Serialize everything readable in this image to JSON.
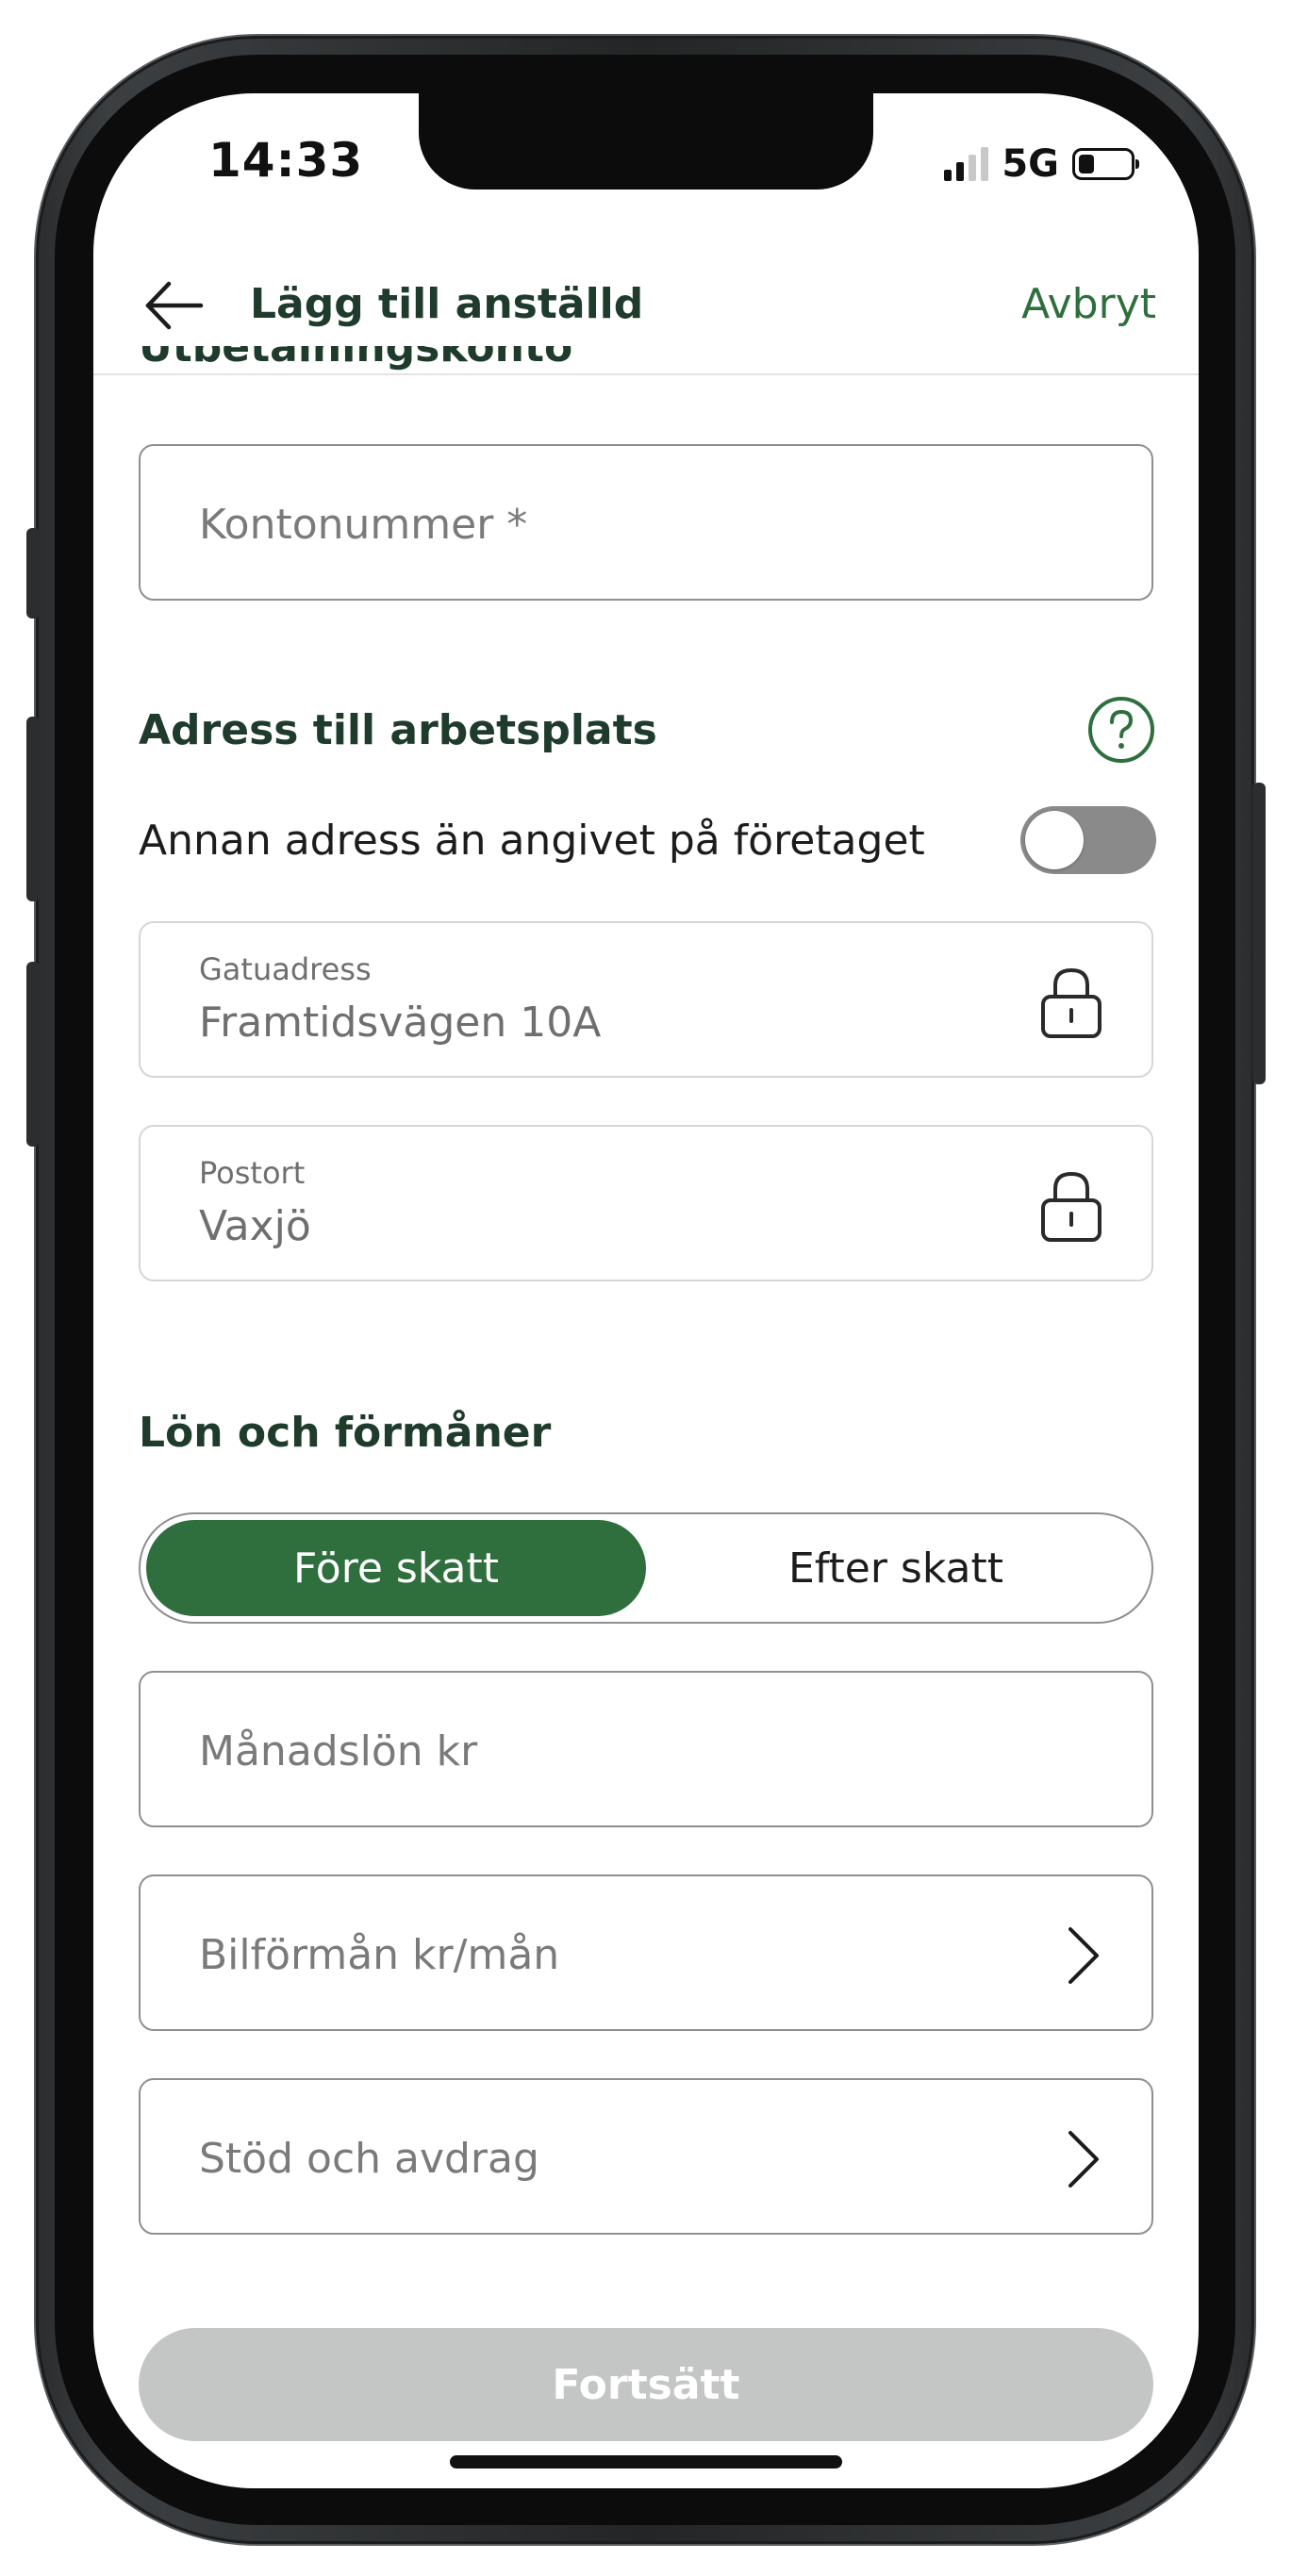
{
  "status_bar": {
    "time": "14:33",
    "network": "5G",
    "signal_bars_active": 2,
    "battery_level": 0.3
  },
  "header": {
    "title": "Lägg till anställd",
    "cancel_label": "Avbryt",
    "back_icon": "arrow-left-icon"
  },
  "clipped_section_title": "Utbetalningskonto",
  "account_field": {
    "placeholder": "Kontonummer *"
  },
  "workplace": {
    "title": "Adress till arbetsplats",
    "help_icon": "question-circle-icon",
    "toggle_label": "Annan adress än angivet på företaget",
    "toggle_on": false,
    "street": {
      "label": "Gatuadress",
      "value": "Framtidsvägen 10A",
      "icon": "lock-icon"
    },
    "city": {
      "label": "Postort",
      "value": "Vaxjö",
      "icon": "lock-icon"
    }
  },
  "salary": {
    "title": "Lön och förmåner",
    "segment_before_tax": "Före skatt",
    "segment_after_tax": "Efter skatt",
    "selected_segment": "Före skatt",
    "monthly_salary_placeholder": "Månadslön kr",
    "car_benefit_label": "Bilförmån kr/mån",
    "support_deductions_label": "Stöd och avdrag"
  },
  "continue_label": "Fortsätt",
  "colors": {
    "brand_green": "#2f6f3e",
    "title_green": "#1e3b2b",
    "disabled_button": "#c4c6c5",
    "toggle_off": "#8a8a8a"
  }
}
